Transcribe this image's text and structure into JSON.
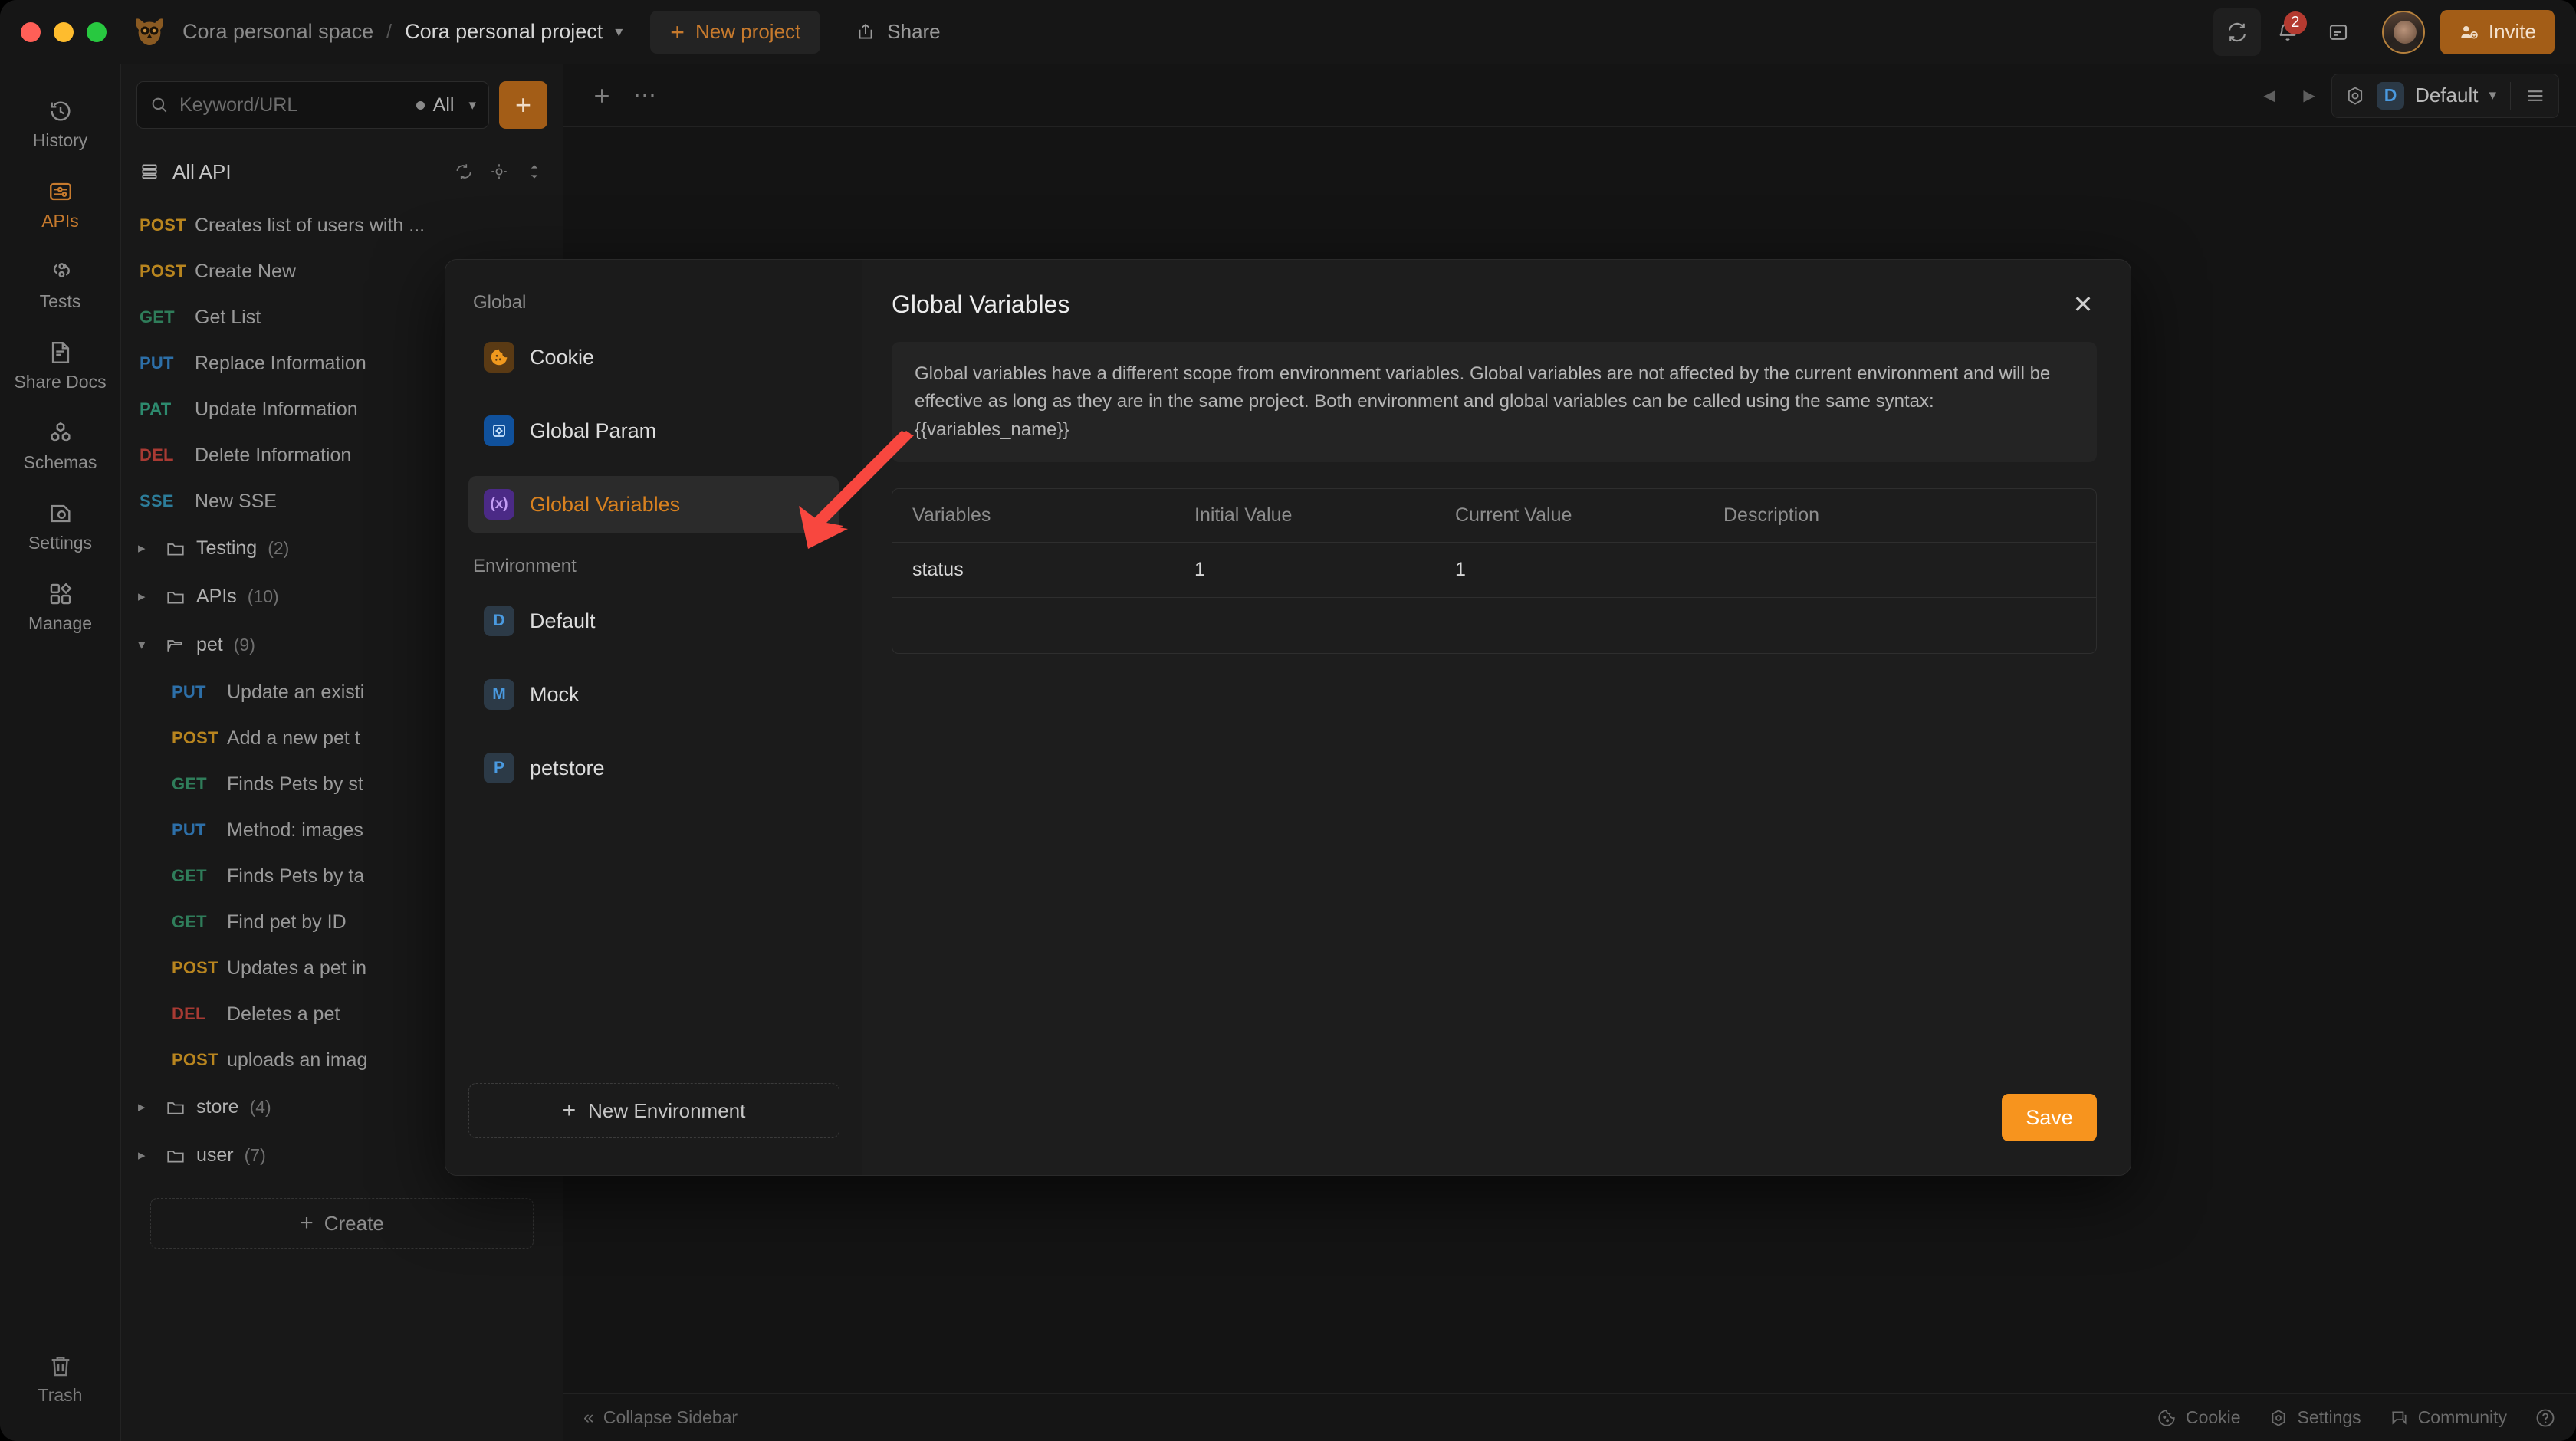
{
  "titlebar": {
    "workspace": "Cora personal space",
    "separator": "/",
    "project": "Cora personal project",
    "new_project": "New project",
    "share": "Share",
    "invite": "Invite",
    "notification_count": "2",
    "icons": [
      "owl-logo-icon",
      "chevron-down-icon",
      "sync-icon",
      "bell-icon",
      "panel-icon",
      "avatar",
      "user-add-icon"
    ]
  },
  "rail": {
    "items": [
      {
        "label": "History",
        "icon": "history-icon",
        "active": false
      },
      {
        "label": "APIs",
        "icon": "apis-icon",
        "active": true
      },
      {
        "label": "Tests",
        "icon": "tests-icon",
        "active": false
      },
      {
        "label": "Share Docs",
        "icon": "share-docs-icon",
        "active": false
      },
      {
        "label": "Schemas",
        "icon": "schemas-icon",
        "active": false
      },
      {
        "label": "Settings",
        "icon": "settings-icon",
        "active": false
      },
      {
        "label": "Manage",
        "icon": "manage-icon",
        "active": false
      }
    ],
    "trash": {
      "label": "Trash",
      "icon": "trash-icon"
    }
  },
  "listpanel": {
    "search_placeholder": "Keyword/URL",
    "filter_label": "All",
    "add_button": "+",
    "all_api_label": "All API",
    "create_label": "Create",
    "items": [
      {
        "method": "POST",
        "name": "Creates list of users with ...",
        "cls": "m-post"
      },
      {
        "method": "POST",
        "name": "Create New",
        "cls": "m-post"
      },
      {
        "method": "GET",
        "name": "Get List",
        "cls": "m-get"
      },
      {
        "method": "PUT",
        "name": "Replace Information",
        "cls": "m-put"
      },
      {
        "method": "PAT",
        "name": "Update Information",
        "cls": "m-pat"
      },
      {
        "method": "DEL",
        "name": "Delete Information",
        "cls": "m-del"
      },
      {
        "method": "SSE",
        "name": "New SSE",
        "cls": "m-sse"
      }
    ],
    "folders": [
      {
        "name": "Testing",
        "count": "(2)",
        "expanded": false
      },
      {
        "name": "APIs",
        "count": "(10)",
        "expanded": false
      }
    ],
    "pet_folder": {
      "name": "pet",
      "count": "(9)",
      "expanded": true
    },
    "pet_items": [
      {
        "method": "PUT",
        "name": "Update an existi",
        "cls": "m-put"
      },
      {
        "method": "POST",
        "name": "Add a new pet t",
        "cls": "m-post"
      },
      {
        "method": "GET",
        "name": "Finds Pets by st",
        "cls": "m-get"
      },
      {
        "method": "PUT",
        "name": "Method: images",
        "cls": "m-put"
      },
      {
        "method": "GET",
        "name": "Finds Pets by ta",
        "cls": "m-get"
      },
      {
        "method": "GET",
        "name": "Find pet by ID",
        "cls": "m-get"
      },
      {
        "method": "POST",
        "name": "Updates a pet in",
        "cls": "m-post"
      },
      {
        "method": "DEL",
        "name": "Deletes a pet",
        "cls": "m-del"
      },
      {
        "method": "POST",
        "name": "uploads an imag",
        "cls": "m-post"
      }
    ],
    "folders_after": [
      {
        "name": "store",
        "count": "(4)",
        "expanded": false
      },
      {
        "name": "user",
        "count": "(7)",
        "expanded": false
      }
    ]
  },
  "main": {
    "env_chip": "D",
    "env_name": "Default",
    "collapse_sidebar": "Collapse Sidebar",
    "status_items": [
      "Cookie",
      "Settings",
      "Community"
    ]
  },
  "modal": {
    "title": "Global Variables",
    "close": "✕",
    "description": "Global variables have a different scope from environment variables. Global variables are not affected by the current environment and will be effective as long as they are in the same project. Both environment and global variables can be called using the same syntax: {{variables_name}}",
    "global_section": "Global",
    "environment_section": "Environment",
    "global_items": [
      {
        "label": "Cookie",
        "glyph": "●",
        "cls": "cookie",
        "selected": false
      },
      {
        "label": "Global Param",
        "glyph": "⚙",
        "cls": "param",
        "selected": false
      },
      {
        "label": "Global Variables",
        "glyph": "(x)",
        "cls": "varbl",
        "selected": true
      }
    ],
    "environment_items": [
      {
        "label": "Default",
        "glyph": "D",
        "cls": "env"
      },
      {
        "label": "Mock",
        "glyph": "M",
        "cls": "env"
      },
      {
        "label": "petstore",
        "glyph": "P",
        "cls": "env"
      }
    ],
    "new_environment": "New Environment",
    "save": "Save",
    "table": {
      "headers": [
        "Variables",
        "Initial Value",
        "Current Value",
        "Description"
      ],
      "rows": [
        {
          "variable": "status",
          "initial": "1",
          "current": "1",
          "description": ""
        }
      ]
    }
  },
  "colors": {
    "accent_orange": "#f7941e",
    "brand_orange": "#c77a2d",
    "annotation_red": "#f8473f"
  }
}
